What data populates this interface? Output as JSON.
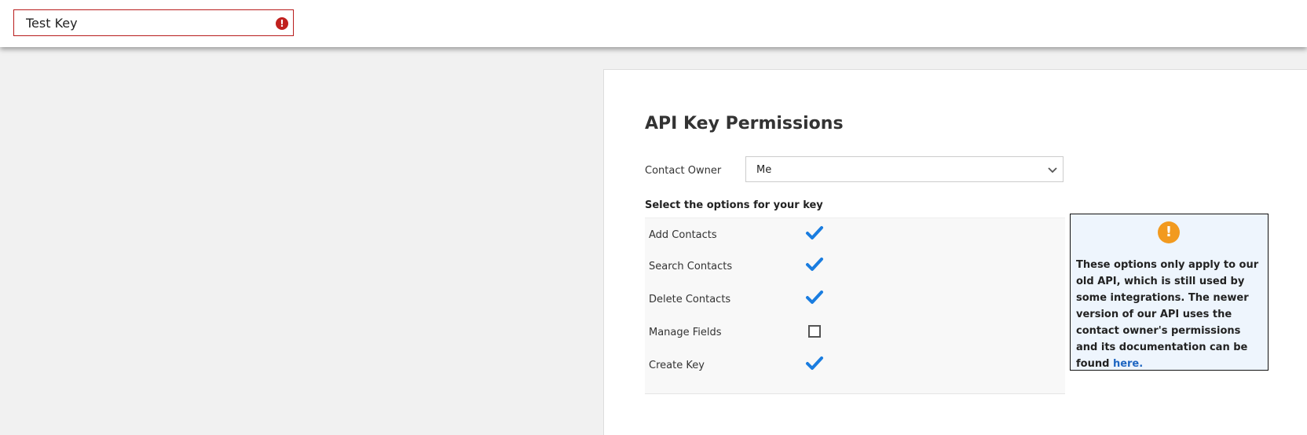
{
  "key_name": {
    "value": "Test Key",
    "error_icon": "exclamation-icon"
  },
  "permissions": {
    "title": "API Key Permissions",
    "contact_owner_label": "Contact Owner",
    "contact_owner_value": "Me",
    "options_heading": "Select the options for your key",
    "options": [
      {
        "label": "Add Contacts",
        "checked": true
      },
      {
        "label": "Search Contacts",
        "checked": true
      },
      {
        "label": "Delete Contacts",
        "checked": true
      },
      {
        "label": "Manage Fields",
        "checked": false
      },
      {
        "label": "Create Key",
        "checked": true
      }
    ]
  },
  "notice": {
    "text": "These options only apply to our old API, which is still used by some integrations. The newer version of our API uses the contact owner's permissions and its documentation can be found ",
    "link_text": "here."
  },
  "colors": {
    "error": "#c0201e",
    "check": "#1a7de0",
    "warning": "#f29a1f",
    "link": "#1f66c1",
    "notice_bg": "#eef5fd"
  }
}
